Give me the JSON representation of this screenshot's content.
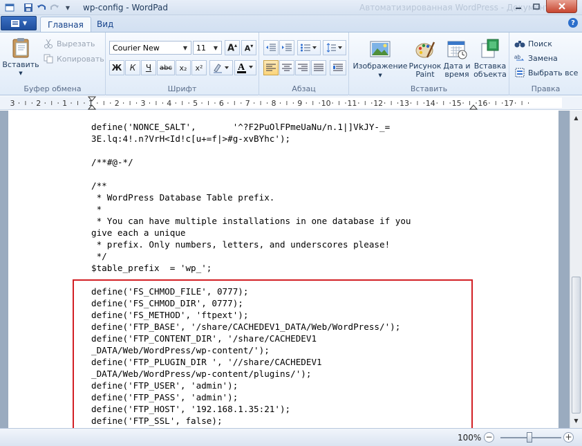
{
  "window": {
    "title": "wp-config - WordPad",
    "faded_title": "Автоматизированная WordPress - Документ"
  },
  "tabs": [
    {
      "label": "Главная",
      "active": true
    },
    {
      "label": "Вид",
      "active": false
    }
  ],
  "ribbon": {
    "clipboard": {
      "group_label": "Буфер обмена",
      "paste": "Вставить",
      "cut": "Вырезать",
      "copy": "Копировать"
    },
    "font": {
      "group_label": "Шрифт",
      "family": "Courier New",
      "size": "11",
      "bold": "Ж",
      "italic": "К",
      "underline": "Ч",
      "strike": "abc",
      "subscript": "x₂",
      "superscript": "x²"
    },
    "paragraph": {
      "group_label": "Абзац"
    },
    "insert": {
      "group_label": "Вставить",
      "image": "Изображение",
      "paint_line1": "Рисунок",
      "paint_line2": "Paint",
      "datetime_line1": "Дата и",
      "datetime_line2": "время",
      "object_line1": "Вставка",
      "object_line2": "объекта"
    },
    "editing": {
      "group_label": "Правка",
      "find": "Поиск",
      "replace": "Замена",
      "select_all": "Выбрать все"
    }
  },
  "ruler": {
    "labels": [
      "3",
      "2",
      "1",
      "1",
      "2",
      "3",
      "4",
      "5",
      "6",
      "7",
      "8",
      "9",
      "10",
      "11",
      "12",
      "13",
      "14",
      "15",
      "16",
      "17"
    ]
  },
  "document": {
    "lines": [
      "define('NONCE_SALT',       '^?F2PuOlFPmeUaNu/n.1|]VkJY-_=",
      "3E.lq:4!.n?VrH<Id!c[u+=f|>#g-xvBYhc');",
      "",
      "/**#@-*/",
      "",
      "/**",
      " * WordPress Database Table prefix.",
      " *",
      " * You can have multiple installations in one database if you",
      "give each a unique",
      " * prefix. Only numbers, letters, and underscores please!",
      " */",
      "$table_prefix  = 'wp_';",
      "",
      "define('FS_CHMOD_FILE', 0777);",
      "define('FS_CHMOD_DIR', 0777);",
      "define('FS_METHOD', 'ftpext');",
      "define('FTP_BASE', '/share/CACHEDEV1_DATA/Web/WordPress/');",
      "define('FTP_CONTENT_DIR', '/share/CACHEDEV1",
      "_DATA/Web/WordPress/wp-content/');",
      "define('FTP_PLUGIN_DIR ', '//share/CACHEDEV1",
      "_DATA/Web/WordPress/wp-content/plugins/');",
      "define('FTP_USER', 'admin');",
      "define('FTP_PASS', 'admin');",
      "define('FTP_HOST', '192.168.1.35:21');",
      "define('FTP_SSL', false);"
    ]
  },
  "statusbar": {
    "zoom": "100%",
    "zoom_out": "−",
    "zoom_in": "+"
  },
  "colors": {
    "highlight_box": "#d21f24",
    "ribbon_text": "#1e395b"
  }
}
